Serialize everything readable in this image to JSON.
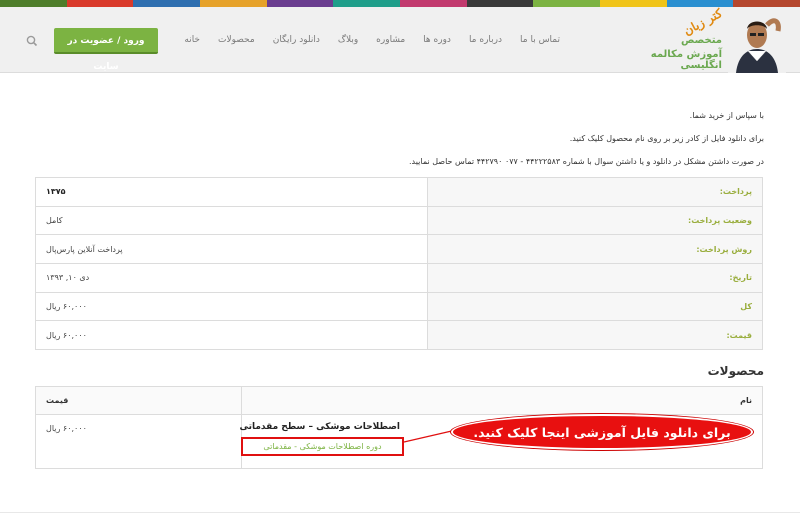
{
  "top_strip_colors": [
    "#4e7d2a",
    "#d93a2b",
    "#2f6fb0",
    "#e6a22a",
    "#6a3d8f",
    "#1f9e8a",
    "#c23a6e",
    "#3a3a3a",
    "#7cb342",
    "#f0c419",
    "#2a8fd0",
    "#b5472e"
  ],
  "brand": {
    "logo_text": "کتر زبان",
    "tagline_line1": "متخصص",
    "tagline_line2": "آموزش مکالمه انگلیسی"
  },
  "nav": {
    "items": [
      "خانه",
      "محصولات",
      "دانلود رایگان",
      "وبلاگ",
      "مشاوره",
      "دوره ها",
      "درباره ما",
      "تماس با ما"
    ],
    "login_label": "ورود / عضویت در سایت"
  },
  "messages": {
    "thanks": "با سپاس از خرید شما.",
    "download_hint": "برای دانلود فایل از کادر زیر بر روی نام محصول کلیک کنید.",
    "support": "در صورت داشتن مشکل در دانلود و یا داشتن سوال با شماره ۴۴۲۲۲۵۸۳ - ۰۷۷ ۴۴۲۷۹۰ تماس حاصل نمایید."
  },
  "summary": {
    "rows": [
      {
        "label": "پرداخت:",
        "value": "۱۳۷۵",
        "bold": true
      },
      {
        "label": "وضعیت پرداخت:",
        "value": "کامل",
        "bold": false
      },
      {
        "label": "روش پرداخت:",
        "value": "پرداخت آنلاین پارس‌پال",
        "bold": false
      },
      {
        "label": "تاریخ:",
        "value": "دی ۱۰, ۱۳۹۳",
        "bold": false
      },
      {
        "label": "کل",
        "value": "۶۰,۰۰۰ ریال",
        "bold": false
      },
      {
        "label": "قیمت:",
        "value": "۶۰,۰۰۰ ریال",
        "bold": false
      }
    ]
  },
  "products": {
    "title": "محصولات",
    "header_name": "نام",
    "header_price": "قیمت",
    "item": {
      "name": "اصطلاحات موشکی – سطح مقدماتی",
      "link_text": "دوره اصطلاحات موشکی - مقدماتی",
      "price": "۶۰,۰۰۰ ریال"
    }
  },
  "callout": {
    "text": "برای دانلود فایل آموزشی اینجا کلیک کنید.",
    "color": "#e81010"
  },
  "accent_color": "#7cb342"
}
